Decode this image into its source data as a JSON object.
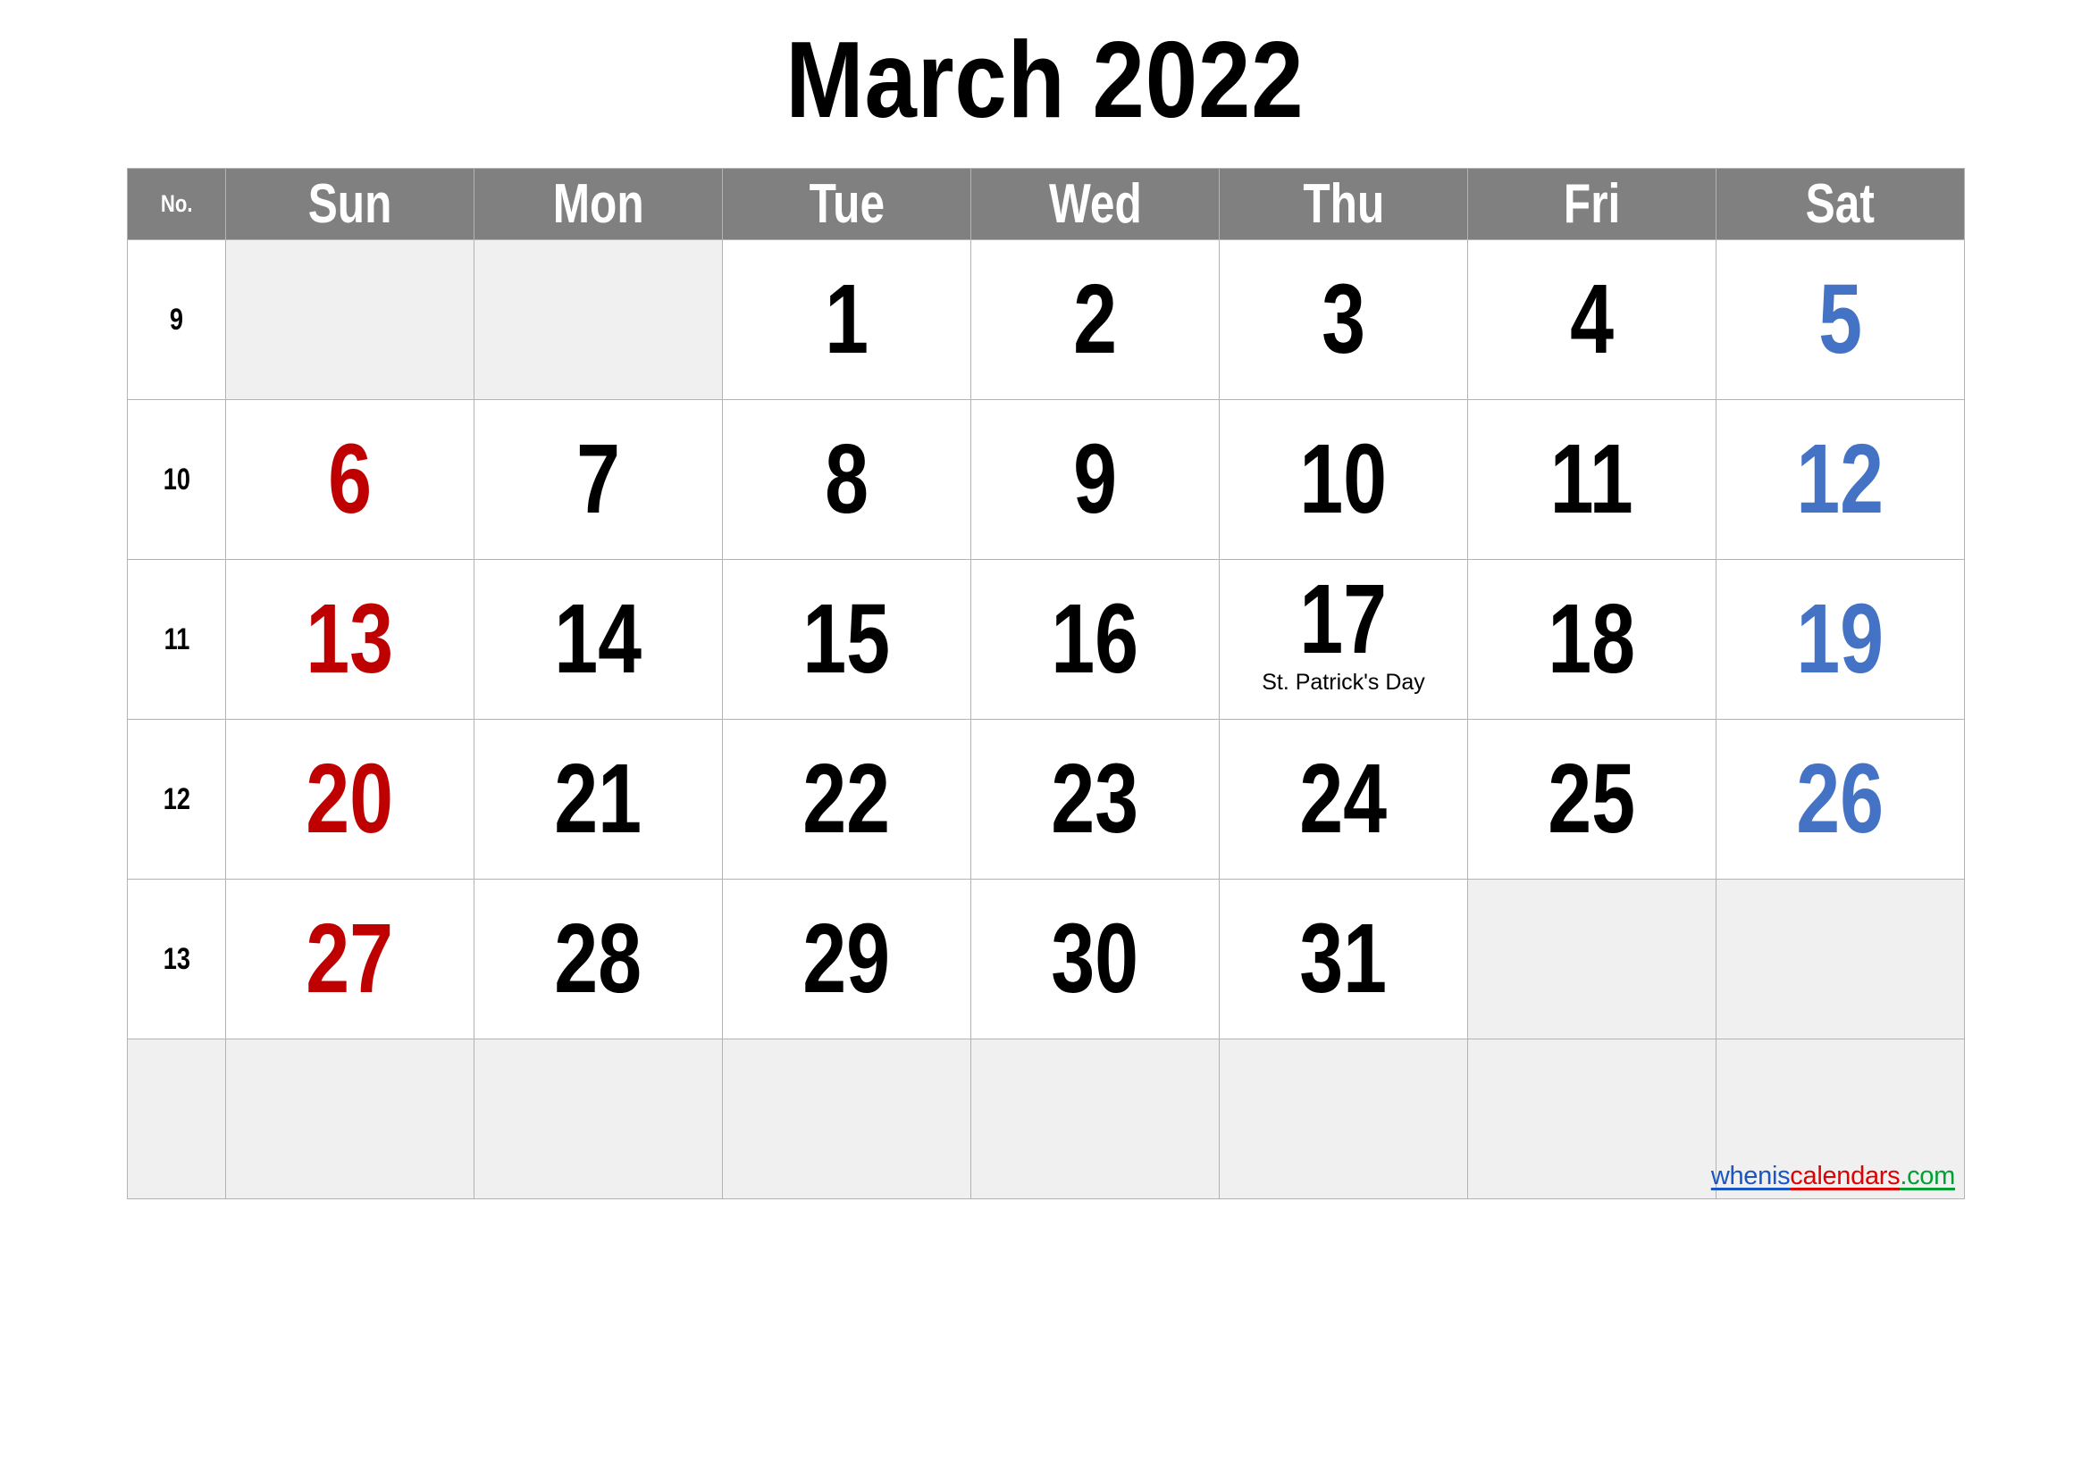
{
  "title": "March 2022",
  "header": {
    "week_number_label": "No.",
    "days": [
      "Sun",
      "Mon",
      "Tue",
      "Wed",
      "Thu",
      "Fri",
      "Sat"
    ]
  },
  "colors": {
    "header_background": "#808080",
    "header_text": "#ffffff",
    "weekday_number": "#000000",
    "sunday_number": "#bf0000",
    "saturday_number": "#4472c4",
    "empty_cell_background": "#f0f0f0",
    "cell_background": "#ffffff",
    "grid_line": "#b3b3b3"
  },
  "weeks": [
    {
      "number": "9",
      "days": [
        {
          "num": "",
          "empty": true,
          "holiday": ""
        },
        {
          "num": "",
          "empty": true,
          "holiday": ""
        },
        {
          "num": "1",
          "empty": false,
          "holiday": ""
        },
        {
          "num": "2",
          "empty": false,
          "holiday": ""
        },
        {
          "num": "3",
          "empty": false,
          "holiday": ""
        },
        {
          "num": "4",
          "empty": false,
          "holiday": ""
        },
        {
          "num": "5",
          "empty": false,
          "holiday": ""
        }
      ]
    },
    {
      "number": "10",
      "days": [
        {
          "num": "6",
          "empty": false,
          "holiday": ""
        },
        {
          "num": "7",
          "empty": false,
          "holiday": ""
        },
        {
          "num": "8",
          "empty": false,
          "holiday": ""
        },
        {
          "num": "9",
          "empty": false,
          "holiday": ""
        },
        {
          "num": "10",
          "empty": false,
          "holiday": ""
        },
        {
          "num": "11",
          "empty": false,
          "holiday": ""
        },
        {
          "num": "12",
          "empty": false,
          "holiday": ""
        }
      ]
    },
    {
      "number": "11",
      "days": [
        {
          "num": "13",
          "empty": false,
          "holiday": ""
        },
        {
          "num": "14",
          "empty": false,
          "holiday": ""
        },
        {
          "num": "15",
          "empty": false,
          "holiday": ""
        },
        {
          "num": "16",
          "empty": false,
          "holiday": ""
        },
        {
          "num": "17",
          "empty": false,
          "holiday": "St. Patrick's Day"
        },
        {
          "num": "18",
          "empty": false,
          "holiday": ""
        },
        {
          "num": "19",
          "empty": false,
          "holiday": ""
        }
      ]
    },
    {
      "number": "12",
      "days": [
        {
          "num": "20",
          "empty": false,
          "holiday": ""
        },
        {
          "num": "21",
          "empty": false,
          "holiday": ""
        },
        {
          "num": "22",
          "empty": false,
          "holiday": ""
        },
        {
          "num": "23",
          "empty": false,
          "holiday": ""
        },
        {
          "num": "24",
          "empty": false,
          "holiday": ""
        },
        {
          "num": "25",
          "empty": false,
          "holiday": ""
        },
        {
          "num": "26",
          "empty": false,
          "holiday": ""
        }
      ]
    },
    {
      "number": "13",
      "days": [
        {
          "num": "27",
          "empty": false,
          "holiday": ""
        },
        {
          "num": "28",
          "empty": false,
          "holiday": ""
        },
        {
          "num": "29",
          "empty": false,
          "holiday": ""
        },
        {
          "num": "30",
          "empty": false,
          "holiday": ""
        },
        {
          "num": "31",
          "empty": false,
          "holiday": ""
        },
        {
          "num": "",
          "empty": true,
          "holiday": ""
        },
        {
          "num": "",
          "empty": true,
          "holiday": ""
        }
      ]
    },
    {
      "number": "",
      "days": [
        {
          "num": "",
          "empty": true,
          "holiday": ""
        },
        {
          "num": "",
          "empty": true,
          "holiday": ""
        },
        {
          "num": "",
          "empty": true,
          "holiday": ""
        },
        {
          "num": "",
          "empty": true,
          "holiday": ""
        },
        {
          "num": "",
          "empty": true,
          "holiday": ""
        },
        {
          "num": "",
          "empty": true,
          "holiday": ""
        },
        {
          "num": "",
          "empty": true,
          "holiday": ""
        }
      ]
    }
  ],
  "watermark": {
    "part1": "whenis",
    "part2": "calendars",
    "part3": ".com"
  }
}
